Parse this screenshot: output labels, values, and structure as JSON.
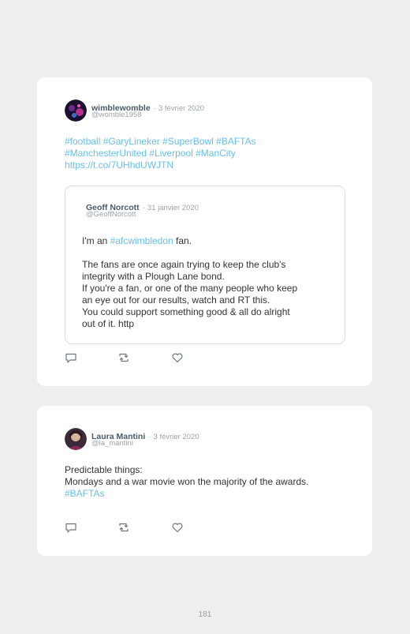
{
  "tweets": [
    {
      "author": "wimblewomble",
      "date": "· 3 février 2020",
      "handle": "@womble1958",
      "body_lines": [
        [
          {
            "text": "#football",
            "link": true
          },
          {
            "text": " ",
            "link": false
          },
          {
            "text": "#GaryLineker",
            "link": true
          },
          {
            "text": " ",
            "link": false
          },
          {
            "text": "#SuperBowl",
            "link": true
          },
          {
            "text": " ",
            "link": false
          },
          {
            "text": "#BAFTAs",
            "link": true
          }
        ],
        [
          {
            "text": "#ManchesterUnited",
            "link": true
          },
          {
            "text": " ",
            "link": false
          },
          {
            "text": "#Liverpool",
            "link": true
          },
          {
            "text": " ",
            "link": false
          },
          {
            "text": "#ManCity",
            "link": true
          }
        ],
        [
          {
            "text": "https://t.co/7UHhdUWJTN",
            "link": true
          }
        ]
      ],
      "quote": {
        "author": "Geoff Norcott",
        "date": "· 31 janvier 2020",
        "handle": "@GeoffNorcott",
        "body_lines": [
          [
            {
              "text": "I'm an ",
              "link": false
            },
            {
              "text": "#afcwimbledon",
              "link": true
            },
            {
              "text": " fan.",
              "link": false
            }
          ],
          [
            {
              "text": "",
              "link": false
            }
          ],
          [
            {
              "text": "The fans are once again trying to keep the club's",
              "link": false
            }
          ],
          [
            {
              "text": "integrity with a Plough Lane bond.",
              "link": false
            }
          ],
          [
            {
              "text": "If you're a fan, or one of the many people who keep",
              "link": false
            }
          ],
          [
            {
              "text": "an eye out for our results, watch and RT this.",
              "link": false
            }
          ],
          [
            {
              "text": "You could support something good & all do alright",
              "link": false
            }
          ],
          [
            {
              "text": "out of it. http",
              "link": false
            }
          ]
        ]
      },
      "avatar_icon": "avatar-wimblewomble"
    },
    {
      "author": "Laura Mantini",
      "date": "· 3 février 2020",
      "handle": "@la_mantini",
      "body_lines": [
        [
          {
            "text": "Predictable things:",
            "link": false
          }
        ],
        [
          {
            "text": "Mondays and a war movie won the majority of the awards.",
            "link": false
          }
        ],
        [
          {
            "text": "#BAFTAs",
            "link": true
          }
        ]
      ],
      "avatar_icon": "avatar-laura-mantini"
    }
  ],
  "actions": [
    "reply-icon",
    "retweet-icon",
    "like-icon"
  ],
  "colors": {
    "link": "#67c0e6",
    "name": "#4a5a66",
    "muted": "#9aa4ab",
    "background": "#eeeeee",
    "card": "#ffffff"
  },
  "page_number": "181"
}
